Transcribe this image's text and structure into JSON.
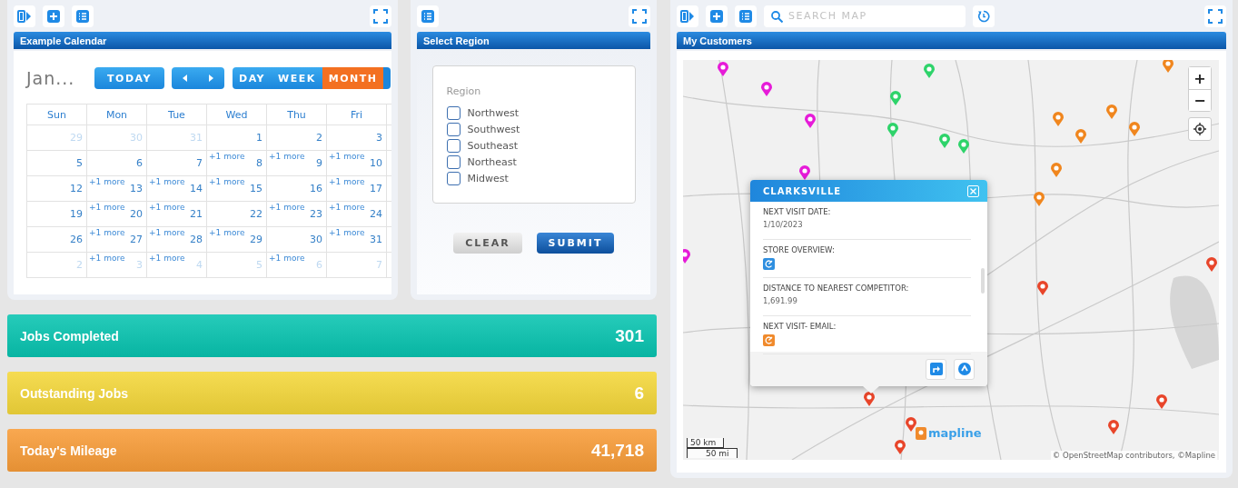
{
  "calendar_panel": {
    "title": "Example Calendar",
    "calendar": {
      "month_label": "Jan...",
      "today": "TODAY",
      "views": [
        {
          "label": "DAY",
          "selected": false
        },
        {
          "label": "WEEK",
          "selected": false
        },
        {
          "label": "MONTH",
          "selected": true
        }
      ],
      "weekdays": [
        "Sun",
        "Mon",
        "Tue",
        "Wed",
        "Thu",
        "Fri"
      ],
      "weeks": [
        [
          {
            "day": "29",
            "other_month": true
          },
          {
            "day": "30",
            "other_month": true
          },
          {
            "day": "31",
            "other_month": true
          },
          {
            "day": "1",
            "other_month": false
          },
          {
            "day": "2",
            "other_month": false
          },
          {
            "day": "3",
            "other_month": false
          }
        ],
        [
          {
            "day": "5",
            "other_month": false
          },
          {
            "day": "6",
            "other_month": false
          },
          {
            "day": "7",
            "other_month": false
          },
          {
            "day": "8",
            "other_month": false,
            "more": "+1 more"
          },
          {
            "day": "9",
            "other_month": false,
            "more": "+1 more"
          },
          {
            "day": "10",
            "other_month": false,
            "more": "+1 more"
          }
        ],
        [
          {
            "day": "12",
            "other_month": false
          },
          {
            "day": "13",
            "other_month": false,
            "more": "+1 more"
          },
          {
            "day": "14",
            "other_month": false,
            "more": "+1 more"
          },
          {
            "day": "15",
            "other_month": false,
            "more": "+1 more"
          },
          {
            "day": "16",
            "other_month": false
          },
          {
            "day": "17",
            "other_month": false,
            "more": "+1 more"
          }
        ],
        [
          {
            "day": "19",
            "other_month": false
          },
          {
            "day": "20",
            "other_month": false,
            "more": "+1 more"
          },
          {
            "day": "21",
            "other_month": false,
            "more": "+1 more"
          },
          {
            "day": "22",
            "other_month": false
          },
          {
            "day": "23",
            "other_month": false,
            "more": "+1 more"
          },
          {
            "day": "24",
            "other_month": false,
            "more": "+1 more"
          }
        ],
        [
          {
            "day": "26",
            "other_month": false
          },
          {
            "day": "27",
            "other_month": false,
            "more": "+1 more"
          },
          {
            "day": "28",
            "other_month": false,
            "more": "+1 more"
          },
          {
            "day": "29",
            "other_month": false,
            "more": "+1 more"
          },
          {
            "day": "30",
            "other_month": false
          },
          {
            "day": "31",
            "other_month": false,
            "more": "+1 more"
          }
        ],
        [
          {
            "day": "2",
            "other_month": true
          },
          {
            "day": "3",
            "other_month": true,
            "more": "+1 more"
          },
          {
            "day": "4",
            "other_month": true,
            "more": "+1 more"
          },
          {
            "day": "5",
            "other_month": true
          },
          {
            "day": "6",
            "other_month": true,
            "more": "+1 more"
          },
          {
            "day": "7",
            "other_month": true
          }
        ]
      ]
    }
  },
  "region_panel": {
    "title": "Select Region",
    "legend": "Region",
    "options": [
      {
        "label": "Northwest",
        "checked": false
      },
      {
        "label": "Southwest",
        "checked": false
      },
      {
        "label": "Southeast",
        "checked": false
      },
      {
        "label": "Northeast",
        "checked": false
      },
      {
        "label": "Midwest",
        "checked": false
      }
    ],
    "buttons": [
      {
        "label": "CLEAR",
        "kind": "secondary"
      },
      {
        "label": "SUBMIT",
        "kind": "primary"
      }
    ]
  },
  "stats": [
    {
      "label": "Jobs Completed",
      "value": "301",
      "color": "#08c4b0"
    },
    {
      "label": "Outstanding Jobs",
      "value": "6",
      "color": "#f4d73a"
    },
    {
      "label": "Today's Mileage",
      "value": "41,718",
      "color": "#f89c38"
    }
  ],
  "map_panel": {
    "search": {
      "placeholder": "SEARCH MAP"
    },
    "title": "My Customers",
    "zoom_in": "+",
    "zoom_out": "−",
    "popup": {
      "title": "CLARKSVILLE",
      "fields": [
        {
          "label": "NEXT VISIT DATE:",
          "kind": "text",
          "value": "1/10/2023"
        },
        {
          "label": "STORE OVERVIEW:",
          "kind": "icon",
          "color": "#2f8fe0"
        },
        {
          "label": "DISTANCE TO NEAREST COMPETITOR:",
          "kind": "text",
          "value": "1,691.99"
        },
        {
          "label": "NEXT VISIT- EMAIL:",
          "kind": "icon",
          "color": "#f08a2c"
        }
      ]
    },
    "scale": [
      "50 km",
      "50 mi"
    ],
    "logo": "mapline",
    "attribution": "© OpenStreetMap contributors, ©Mapline"
  }
}
